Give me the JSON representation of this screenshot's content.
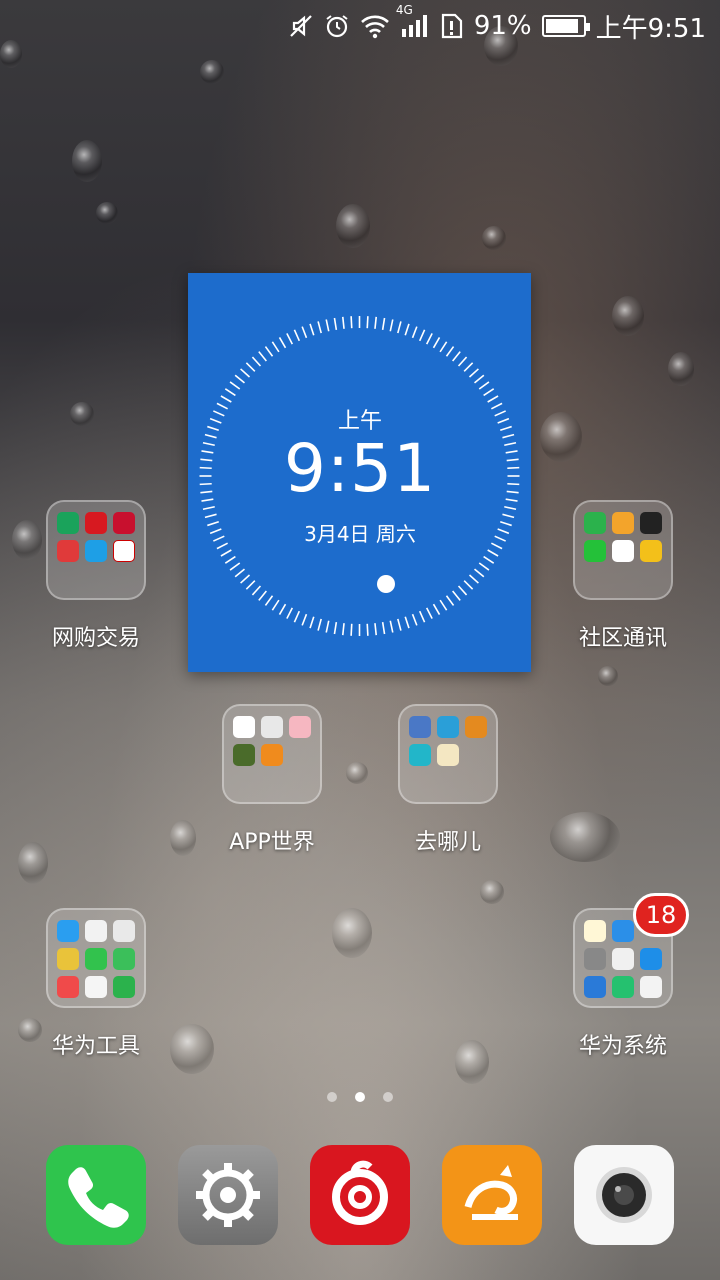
{
  "status_bar": {
    "network": "4G",
    "battery": "91%",
    "battery_level": 0.91,
    "time": "上午9:51"
  },
  "clock_widget": {
    "ampm": "上午",
    "time": "9:51",
    "date": "3月4日 周六"
  },
  "folders": {
    "shopping": {
      "label": "网购交易"
    },
    "social": {
      "label": "社区通讯"
    },
    "app_world": {
      "label": "APP世界"
    },
    "travel": {
      "label": "去哪儿"
    },
    "huawei_tools": {
      "label": "华为工具"
    },
    "huawei_system": {
      "label": "华为系统",
      "badge": "18"
    }
  },
  "pages": {
    "count": 3,
    "current": 2
  },
  "dock": {
    "items": [
      "phone-icon",
      "settings-icon",
      "netease-music-icon",
      "uc-browser-icon",
      "camera-icon"
    ]
  }
}
